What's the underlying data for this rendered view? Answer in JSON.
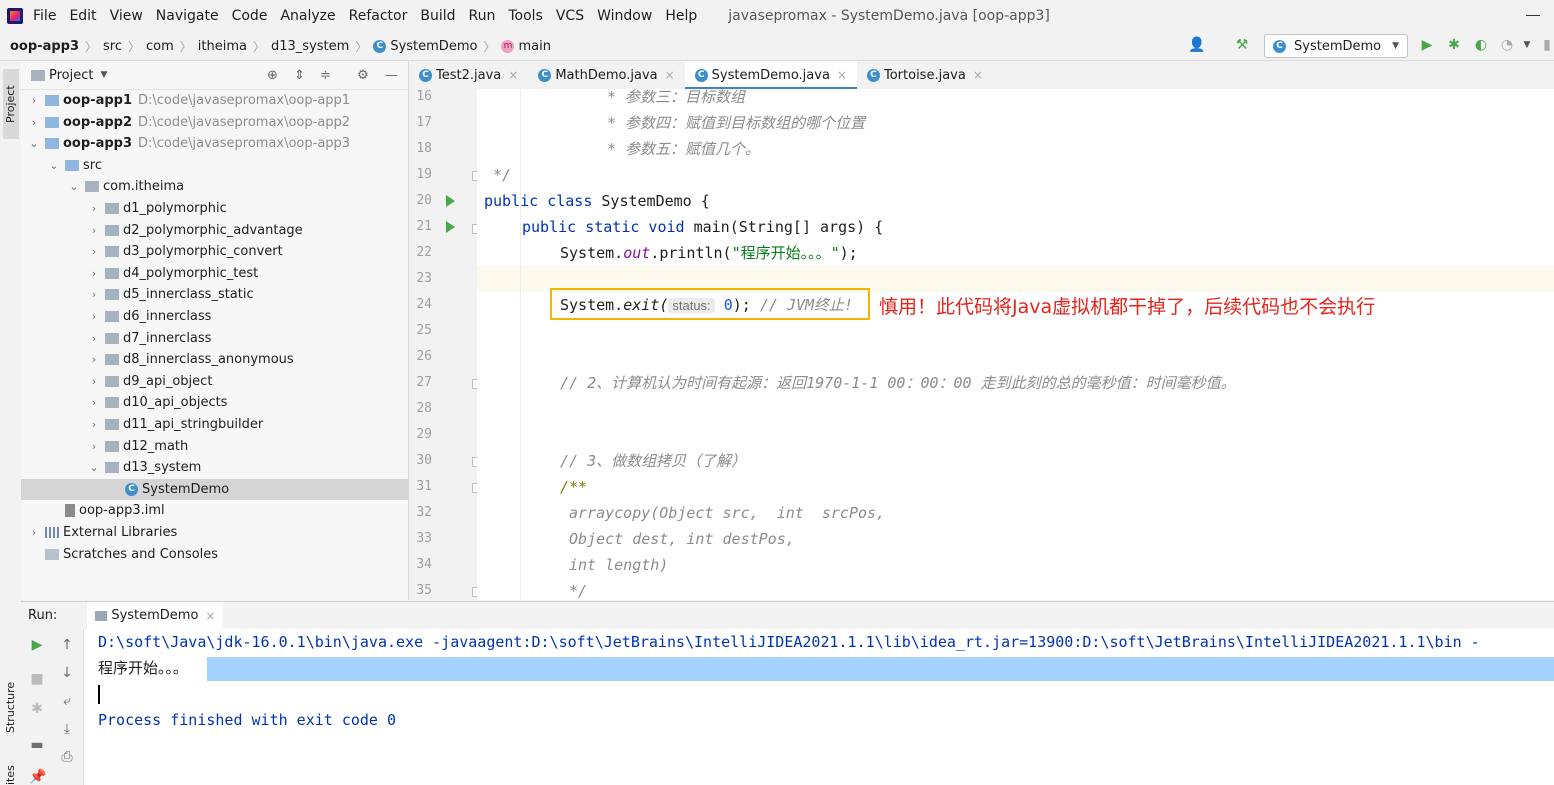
{
  "menubar": {
    "items": [
      "File",
      "Edit",
      "View",
      "Navigate",
      "Code",
      "Analyze",
      "Refactor",
      "Build",
      "Run",
      "Tools",
      "VCS",
      "Window",
      "Help"
    ],
    "window_title": "javasepromax - SystemDemo.java [oop-app3]"
  },
  "breadcrumb": {
    "items": [
      "oop-app3",
      "src",
      "com",
      "itheima",
      "d13_system",
      "SystemDemo",
      "main"
    ]
  },
  "toolbar": {
    "run_config": "SystemDemo",
    "run_config_icon": "class-icon"
  },
  "left_stripe": {
    "project_label": "Project",
    "structure_label": "Structure",
    "favorites_label": "ites"
  },
  "project_panel": {
    "title": "Project",
    "tree": [
      {
        "label": "oop-app1",
        "path": "D:\\code\\javasepromax\\oop-app1",
        "level": 0,
        "arrow": "›",
        "bold": true
      },
      {
        "label": "oop-app2",
        "path": "D:\\code\\javasepromax\\oop-app2",
        "level": 0,
        "arrow": "›",
        "bold": true
      },
      {
        "label": "oop-app3",
        "path": "D:\\code\\javasepromax\\oop-app3",
        "level": 0,
        "arrow": "⌄",
        "bold": true
      },
      {
        "label": "src",
        "level": 1,
        "arrow": "⌄"
      },
      {
        "label": "com.itheima",
        "level": 2,
        "arrow": "⌄"
      },
      {
        "label": "d1_polymorphic",
        "level": 3,
        "arrow": "›"
      },
      {
        "label": "d2_polymorphic_advantage",
        "level": 3,
        "arrow": "›"
      },
      {
        "label": "d3_polymorphic_convert",
        "level": 3,
        "arrow": "›"
      },
      {
        "label": "d4_polymorphic_test",
        "level": 3,
        "arrow": "›"
      },
      {
        "label": "d5_innerclass_static",
        "level": 3,
        "arrow": "›"
      },
      {
        "label": "d6_innerclass",
        "level": 3,
        "arrow": "›"
      },
      {
        "label": "d7_innerclass",
        "level": 3,
        "arrow": "›"
      },
      {
        "label": "d8_innerclass_anonymous",
        "level": 3,
        "arrow": "›"
      },
      {
        "label": "d9_api_object",
        "level": 3,
        "arrow": "›"
      },
      {
        "label": "d10_api_objects",
        "level": 3,
        "arrow": "›"
      },
      {
        "label": "d11_api_stringbuilder",
        "level": 3,
        "arrow": "›"
      },
      {
        "label": "d12_math",
        "level": 3,
        "arrow": "›"
      },
      {
        "label": "d13_system",
        "level": 3,
        "arrow": "⌄"
      },
      {
        "label": "SystemDemo",
        "level": 4,
        "arrow": "",
        "selected": true
      },
      {
        "label": "oop-app3.iml",
        "level": 1,
        "arrow": ""
      },
      {
        "label": "External Libraries",
        "level": 0,
        "arrow": "›"
      },
      {
        "label": "Scratches and Consoles",
        "level": 0,
        "arrow": ""
      }
    ]
  },
  "editor": {
    "tabs": [
      {
        "label": "Test2.java",
        "active": false
      },
      {
        "label": "MathDemo.java",
        "active": false
      },
      {
        "label": "SystemDemo.java",
        "active": true
      },
      {
        "label": "Tortoise.java",
        "active": false
      }
    ],
    "line_numbers": [
      "16",
      "17",
      "18",
      "19",
      "20",
      "21",
      "22",
      "23",
      "24",
      "25",
      "26",
      "27",
      "28",
      "29",
      "30",
      "31",
      "32",
      "33",
      "34",
      "35"
    ],
    "lines": {
      "l16": "* 参数三：目标数组",
      "l17": "* 参数四：赋值到目标数组的哪个位置",
      "l18": "* 参数五：赋值几个。",
      "l19": "*/",
      "l20_kw": "public class",
      "l20_rest": " SystemDemo {",
      "l21_kw": "public static void",
      "l21_rest": " main(String[] args) {",
      "l22_a": "System.",
      "l22_field": "out",
      "l22_b": ".println(",
      "l22_str": "\"程序开始。。。\"",
      "l22_c": ");",
      "l24_a": "System.",
      "l24_method": "exit(",
      "l24_hint": "status:",
      "l24_num": "0",
      "l24_b": ");",
      "l24_cmt": "// JVM终止!",
      "l27": "// 2、计算机认为时间有起源：返回1970-1-1 00：00：00 走到此刻的总的毫秒值：时间毫秒值。",
      "l30": "// 3、做数组拷贝（了解）",
      "l31": "/**",
      "l32": "arraycopy(Object src,  int  srcPos,",
      "l33": "Object dest, int destPos,",
      "l34": "int length)",
      "l35": "*/"
    },
    "annotation": "慎用！此代码将Java虚拟机都干掉了，后续代码也不会执行",
    "highlight_color": "#f4b400",
    "annotation_color": "#e8231a"
  },
  "run_panel": {
    "label": "Run:",
    "tab": "SystemDemo",
    "console": {
      "cmd": "D:\\soft\\Java\\jdk-16.0.1\\bin\\java.exe -javaagent:D:\\soft\\JetBrains\\IntelliJIDEA2021.1.1\\lib\\idea_rt.jar=13900:D:\\soft\\JetBrains\\IntelliJIDEA2021.1.1\\bin -",
      "output": "程序开始。。。",
      "finished": "Process finished with exit code 0"
    }
  }
}
